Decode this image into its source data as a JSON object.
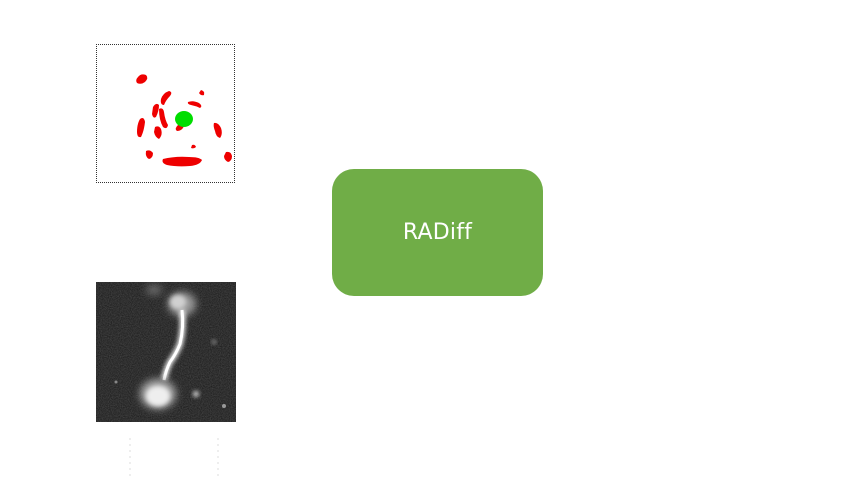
{
  "model_box": {
    "label": "RADiff",
    "fill_color": "#70ad47",
    "text_color": "#ffffff"
  },
  "segmentation_mask": {
    "description_icon": "segmentation-mask-image",
    "compact_color": "#00dd00",
    "extended_color": "#ee0000"
  },
  "radio_image": {
    "description_icon": "radio-galaxy-image"
  }
}
